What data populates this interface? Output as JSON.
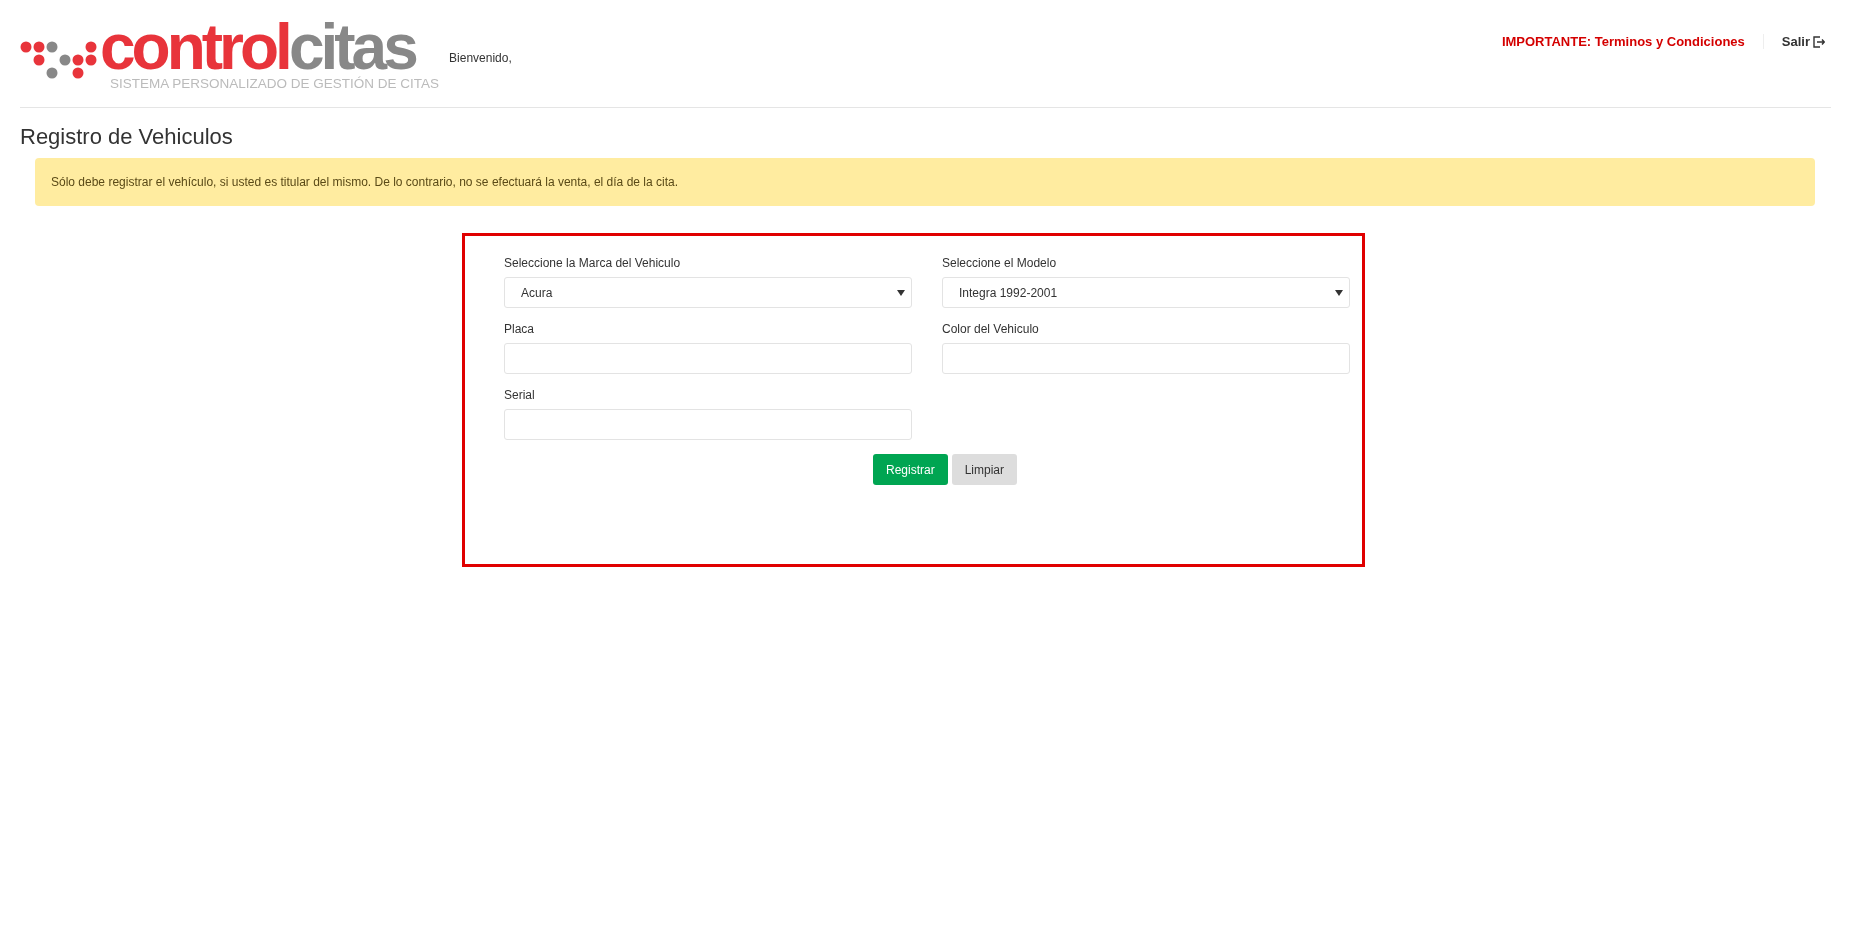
{
  "header": {
    "logo": {
      "word_1": "control",
      "word_2": "citas",
      "tagline": "SISTEMA PERSONALIZADO DE GESTIÓN DE CITAS"
    },
    "greeting": "Bienvenido,",
    "terms_link": "IMPORTANTE: Terminos y Condiciones",
    "logout": "Salir"
  },
  "page_title": "Registro de Vehiculos",
  "alert": "Sólo debe registrar el vehículo, si usted es titular del mismo. De lo contrario, no se efectuará la venta, el día de la cita.",
  "form": {
    "fields": [
      {
        "kind": "select",
        "label": "Seleccione la Marca del Vehiculo",
        "value": "Acura"
      },
      {
        "kind": "select",
        "label": "Seleccione el Modelo",
        "value": "Integra 1992-2001"
      },
      {
        "kind": "text",
        "label": "Placa"
      },
      {
        "kind": "text",
        "label": "Color del Vehiculo"
      },
      {
        "kind": "text",
        "label": "Serial"
      }
    ],
    "buttons": [
      {
        "label": "Registrar",
        "kind": "primary"
      },
      {
        "label": "Limpiar",
        "kind": "secondary"
      }
    ]
  }
}
